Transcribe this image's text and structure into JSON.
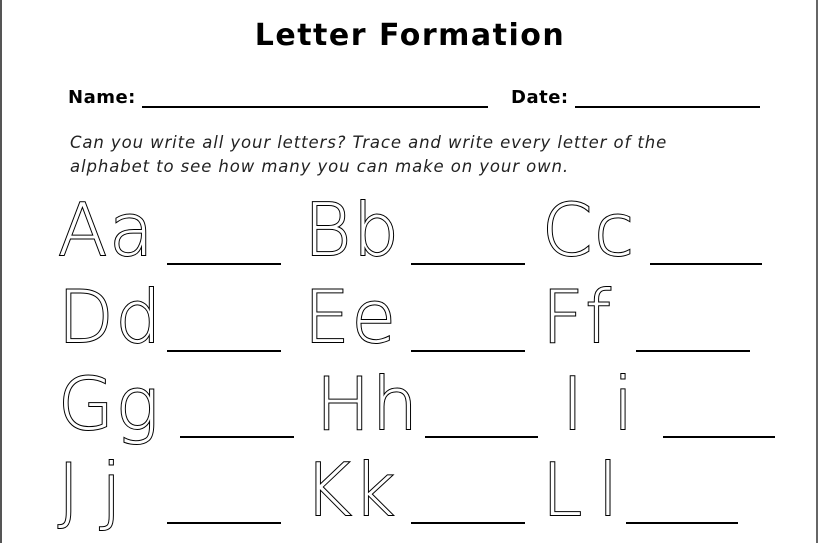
{
  "worksheet": {
    "title": "Letter Formation",
    "name_label": "Name:",
    "date_label": "Date:",
    "instructions_line1": "Can you write all your letters? Trace and write every letter of the",
    "instructions_line2": "alphabet to see how many you can make on your own."
  },
  "letters": [
    {
      "pair": "Aa"
    },
    {
      "pair": "Bb"
    },
    {
      "pair": "Cc"
    },
    {
      "pair": "Dd"
    },
    {
      "pair": "Ee"
    },
    {
      "pair": "Ff"
    },
    {
      "pair": "Gg"
    },
    {
      "pair": "Hh"
    },
    {
      "pair": "Ii"
    },
    {
      "pair": "Jj"
    },
    {
      "pair": "Kk"
    },
    {
      "pair": "Ll"
    }
  ]
}
